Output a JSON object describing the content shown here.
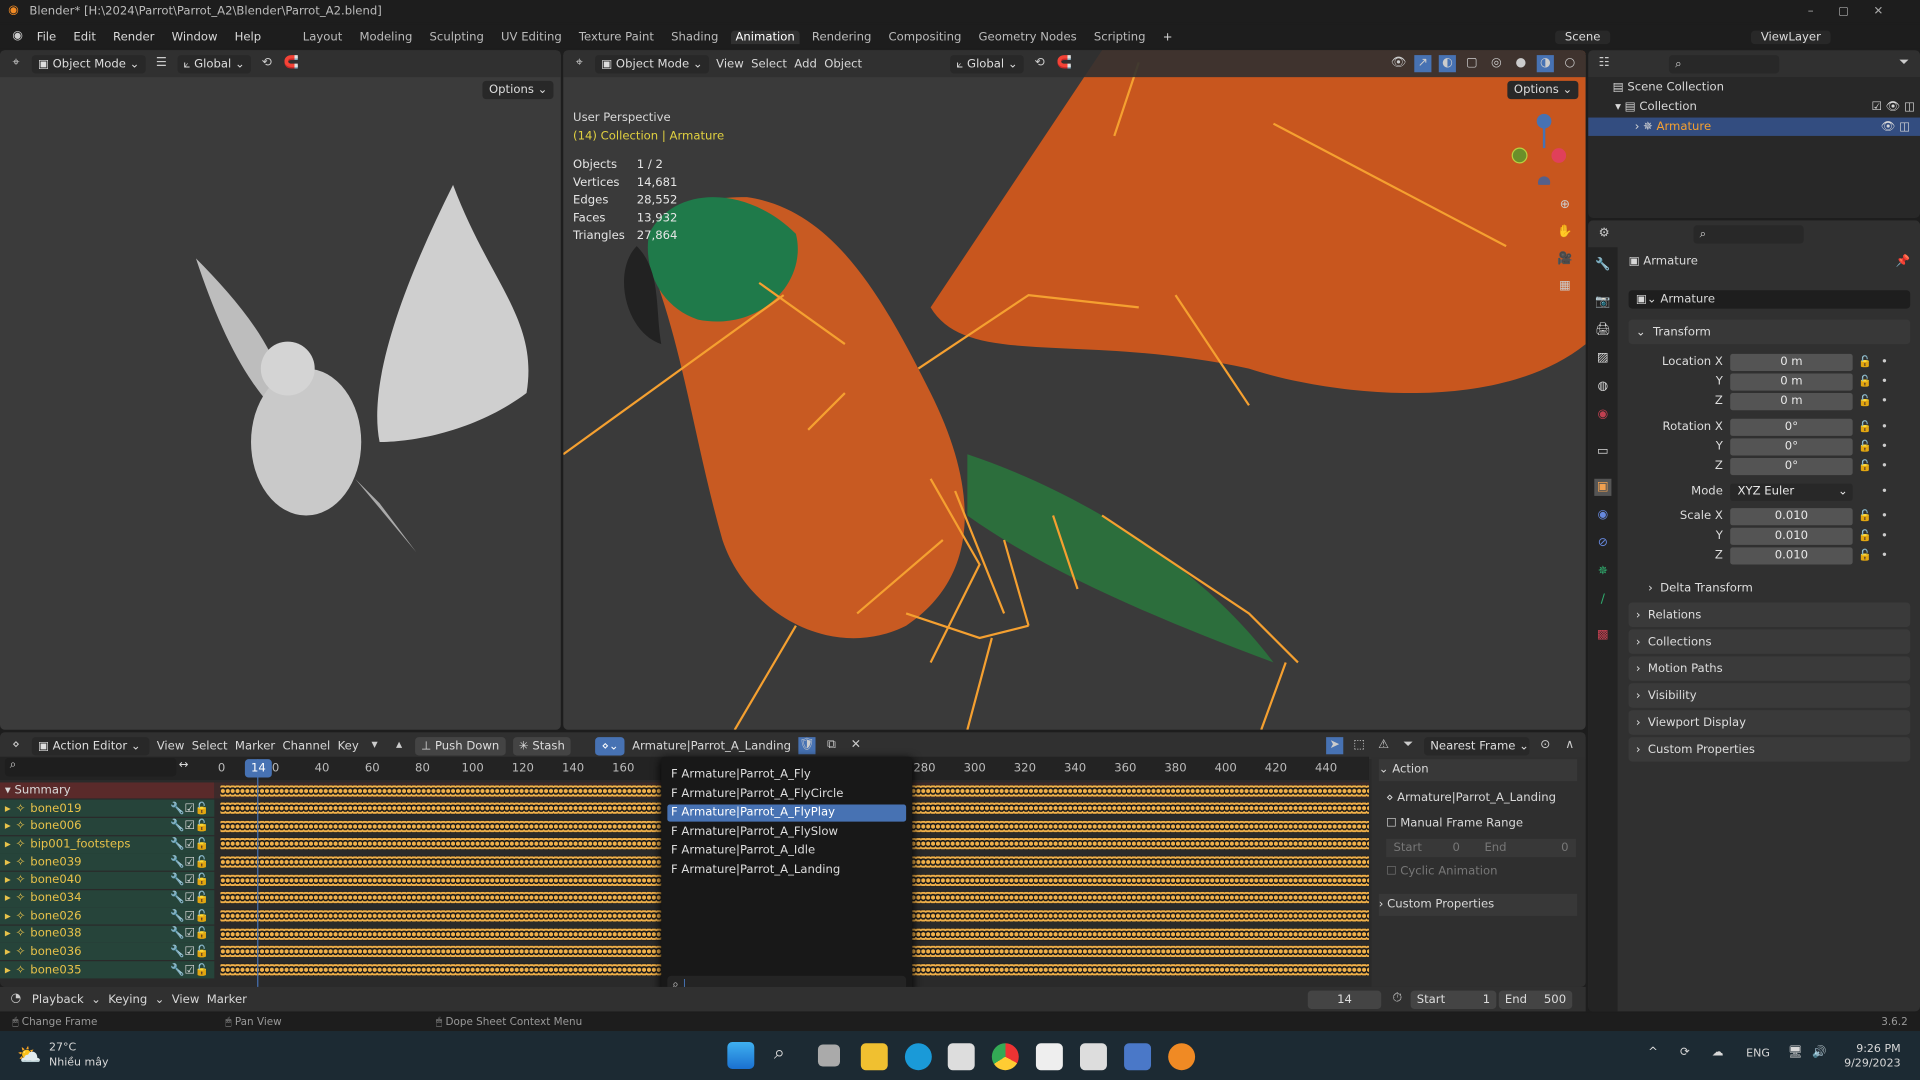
{
  "title_bar": {
    "title": "Blender* [H:\\2024\\Parrot\\Parrot_A2\\Blender\\Parrot_A2.blend]"
  },
  "menu": [
    "File",
    "Edit",
    "Render",
    "Window",
    "Help"
  ],
  "workspaces": [
    "Layout",
    "Modeling",
    "Sculpting",
    "UV Editing",
    "Texture Paint",
    "Shading",
    "Animation",
    "Rendering",
    "Compositing",
    "Geometry Nodes",
    "Scripting"
  ],
  "active_workspace": "Animation",
  "scene": "Scene",
  "view_layer": "ViewLayer",
  "left_viewport": {
    "mode": "Object Mode",
    "orientation": "Global",
    "options": "Options"
  },
  "main_viewport": {
    "mode": "Object Mode",
    "menus": [
      "View",
      "Select",
      "Add",
      "Object"
    ],
    "orientation": "Global",
    "options": "Options",
    "perspective": "User Perspective",
    "context": "(14) Collection | Armature",
    "stats": [
      [
        "Objects",
        "1 / 2"
      ],
      [
        "Vertices",
        "14,681"
      ],
      [
        "Edges",
        "28,552"
      ],
      [
        "Faces",
        "13,932"
      ],
      [
        "Triangles",
        "27,864"
      ]
    ]
  },
  "outliner": {
    "root": "Scene Collection",
    "collection": "Collection",
    "object": "Armature"
  },
  "properties": {
    "object_name": "Armature",
    "datablock": "Armature",
    "transform_label": "Transform",
    "location": {
      "label": "Location X",
      "x": "0 m",
      "y": "0 m",
      "z": "0 m"
    },
    "rotation": {
      "label": "Rotation X",
      "x": "0°",
      "y": "0°",
      "z": "0°"
    },
    "mode_label": "Mode",
    "mode": "XYZ Euler",
    "scale": {
      "label": "Scale X",
      "x": "0.010",
      "y": "0.010",
      "z": "0.010"
    },
    "axis": {
      "y": "Y",
      "z": "Z"
    },
    "panels": [
      "Delta Transform",
      "Relations",
      "Collections",
      "Motion Paths",
      "Visibility",
      "Viewport Display",
      "Custom Properties"
    ]
  },
  "dopesheet": {
    "editor": "Action Editor",
    "menus": [
      "View",
      "Select",
      "Marker",
      "Channel",
      "Key"
    ],
    "push_down": "Push Down",
    "stash": "Stash",
    "action": "Armature|Parrot_A_Landing",
    "snap": "Nearest Frame",
    "current_frame": "14",
    "ticks": [
      "0",
      "20",
      "40",
      "60",
      "80",
      "100",
      "120",
      "140",
      "160",
      "280",
      "300",
      "320",
      "340",
      "360",
      "380",
      "400",
      "420",
      "440"
    ],
    "summary": "Summary",
    "channels": [
      "bone019",
      "bone006",
      "bip001_footsteps",
      "bone039",
      "bone040",
      "bone034",
      "bone026",
      "bone038",
      "bone036",
      "bone035"
    ]
  },
  "action_dropdown": {
    "items": [
      "F Armature|Parrot_A_Fly",
      "F Armature|Parrot_A_FlyCircle",
      "F Armature|Parrot_A_FlyPlay",
      "F Armature|Parrot_A_FlySlow",
      "F Armature|Parrot_A_Idle",
      "F Armature|Parrot_A_Landing"
    ],
    "highlighted": 2,
    "search_value": ""
  },
  "action_panel": {
    "title": "Action",
    "action": "Armature|Parrot_A_Landing",
    "manual_range": "Manual Frame Range",
    "start_label": "Start",
    "start": "0",
    "end_label": "End",
    "end": "0",
    "cyclic": "Cyclic Animation",
    "custom_props": "Custom Properties"
  },
  "timeline": {
    "menus": [
      "Playback",
      "Keying",
      "View",
      "Marker"
    ],
    "frame": "14",
    "start_label": "Start",
    "start": "1",
    "end_label": "End",
    "end": "500"
  },
  "status_bar": {
    "hints": [
      "Change Frame",
      "Pan View",
      "Dope Sheet Context Menu"
    ],
    "version": "3.6.2"
  },
  "taskbar": {
    "temp": "27°C",
    "weather": "Nhiều mây",
    "lang": "ENG",
    "time": "9:26 PM",
    "date": "9/29/2023"
  },
  "colors": {
    "accent": "#4772b3",
    "keyframe": "#f0b04a",
    "channel": "#26443a",
    "summary": "#5a2a2a",
    "bone": "#f5a030"
  }
}
